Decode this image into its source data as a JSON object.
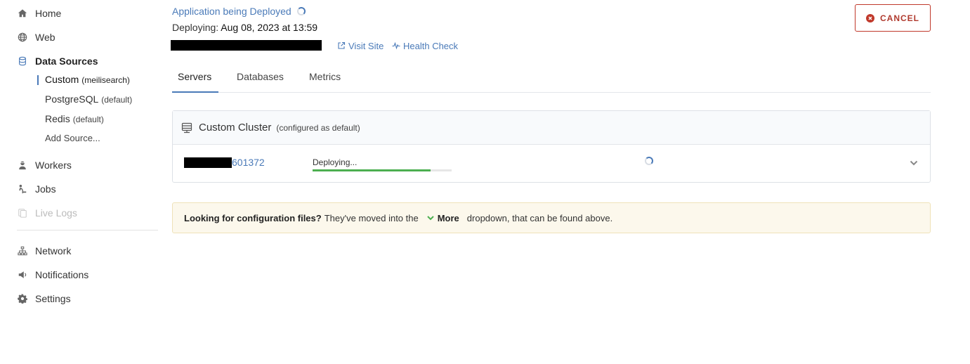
{
  "sidebar": {
    "items": [
      {
        "label": "Home",
        "icon": "home-icon"
      },
      {
        "label": "Web",
        "icon": "globe-icon"
      },
      {
        "label": "Data Sources",
        "icon": "database-icon"
      },
      {
        "label": "Workers",
        "icon": "worker-icon"
      },
      {
        "label": "Jobs",
        "icon": "jobs-icon"
      },
      {
        "label": "Live Logs",
        "icon": "logs-icon"
      },
      {
        "label": "Network",
        "icon": "network-icon"
      },
      {
        "label": "Notifications",
        "icon": "megaphone-icon"
      },
      {
        "label": "Settings",
        "icon": "gear-icon"
      }
    ],
    "data_sources": [
      {
        "label": "Custom",
        "hint": "(meilisearch)"
      },
      {
        "label": "PostgreSQL",
        "hint": "(default)"
      },
      {
        "label": "Redis",
        "hint": "(default)"
      },
      {
        "label": "Add Source..."
      }
    ]
  },
  "header": {
    "title": "Application being Deployed",
    "deploy_prefix": "Deploying:",
    "deploy_time": "Aug 08, 2023 at 13:59",
    "visit_site": "Visit Site",
    "health_check": "Health Check",
    "cancel": "CANCEL"
  },
  "tabs": [
    {
      "label": "Servers",
      "active": true
    },
    {
      "label": "Databases"
    },
    {
      "label": "Metrics"
    }
  ],
  "cluster": {
    "title": "Custom Cluster",
    "hint": "(configured as default)",
    "server_id_suffix": "601372",
    "status": "Deploying...",
    "progress_percent": 85
  },
  "notice": {
    "bold": "Looking for configuration files?",
    "text1": "They've moved into the",
    "more": "More",
    "text2": "dropdown, that can be found above."
  },
  "colors": {
    "accent": "#4a7ab8",
    "danger": "#c0392b",
    "success": "#4caf50",
    "notice_bg": "#fcf8ec"
  }
}
